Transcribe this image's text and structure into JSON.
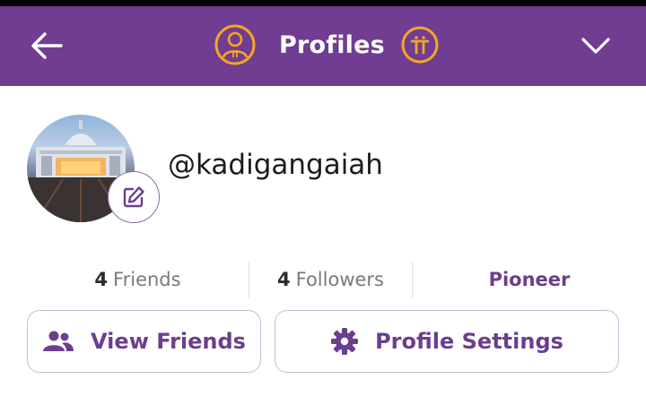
{
  "header": {
    "title": "Profiles",
    "back_icon": "back-arrow-icon",
    "profile_icon": "pi-profile-icon",
    "pi_icon": "pi-logo-icon",
    "menu_icon": "chevron-down-icon",
    "background_color": "#703d92",
    "accent_color": "#f5a623"
  },
  "profile": {
    "username": "@kadigangaiah",
    "edit_icon": "edit-icon"
  },
  "stats": {
    "friends_count": "4",
    "friends_label": "Friends",
    "followers_count": "4",
    "followers_label": "Followers",
    "role": "Pioneer"
  },
  "actions": {
    "view_friends_label": "View Friends",
    "view_friends_icon": "people-icon",
    "profile_settings_label": "Profile Settings",
    "profile_settings_icon": "gear-icon",
    "accent_color": "#6b3e8e"
  }
}
